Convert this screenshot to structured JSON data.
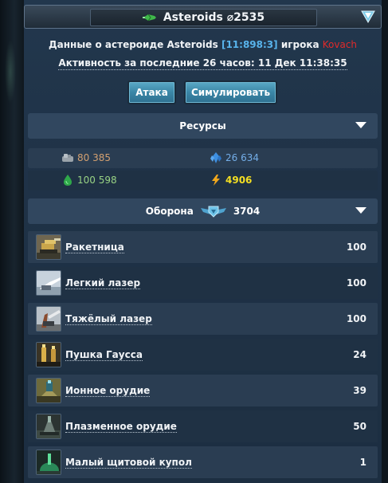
{
  "header": {
    "title": "Asteroids ⌀2535",
    "ship_icon": "spaceship-icon",
    "chevron_icon": "chevron-down-icon"
  },
  "info": {
    "prefix": "Данные о астероиде Asteroids ",
    "coords": "[11:898:3]",
    "mid": " игрока ",
    "player": "Kovach",
    "activity": "Активность за последние 26 часов: 11 Дек 11:38:35"
  },
  "buttons": {
    "attack": "Атака",
    "simulate": "Симулировать"
  },
  "resources_section": {
    "label": "Ресурсы"
  },
  "resources": {
    "metal": "80 385",
    "crystal": "26 634",
    "deuterium": "100 598",
    "energy": "4906"
  },
  "defense_section": {
    "label": "Оборона",
    "total": "3704"
  },
  "defenses": [
    {
      "name": "Ракетница",
      "count": "100"
    },
    {
      "name": "Легкий лазер",
      "count": "100"
    },
    {
      "name": "Тяжёлый лазер",
      "count": "100"
    },
    {
      "name": "Пушка Гаусса",
      "count": "24"
    },
    {
      "name": "Ионное орудие",
      "count": "39"
    },
    {
      "name": "Плазменное орудие",
      "count": "50"
    },
    {
      "name": "Малый щитовой купол",
      "count": "1"
    }
  ],
  "colors": {
    "coords": "#58b4ec",
    "player": "#e02a2a",
    "metal": "#d3a071",
    "crystal": "#74aee8",
    "deuterium": "#98d284",
    "energy": "#f4df22",
    "button": "#3a86a6",
    "section": "#31475f"
  }
}
